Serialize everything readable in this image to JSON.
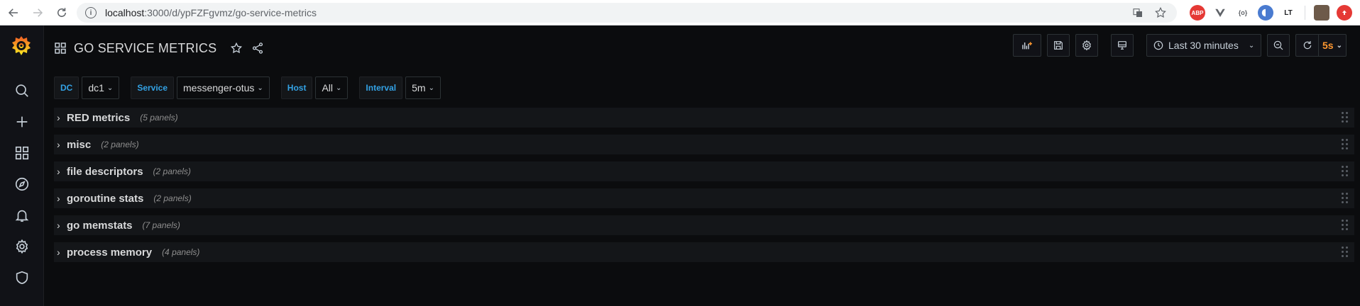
{
  "browser": {
    "url_host": "localhost",
    "url_path": ":3000/d/ypFZFgvmz/go-service-metrics",
    "extensions": [
      "ABP",
      "LT"
    ]
  },
  "dashboard": {
    "title": "GO SERVICE METRICS",
    "time_range": "Last 30 minutes",
    "refresh": "5s"
  },
  "variables": [
    {
      "label": "DC",
      "value": "dc1"
    },
    {
      "label": "Service",
      "value": "messenger-otus"
    },
    {
      "label": "Host",
      "value": "All"
    },
    {
      "label": "Interval",
      "value": "5m"
    }
  ],
  "rows": [
    {
      "title": "RED metrics",
      "count": "(5 panels)"
    },
    {
      "title": "misc",
      "count": "(2 panels)"
    },
    {
      "title": "file descriptors",
      "count": "(2 panels)"
    },
    {
      "title": "goroutine stats",
      "count": "(2 panels)"
    },
    {
      "title": "go memstats",
      "count": "(7 panels)"
    },
    {
      "title": "process memory",
      "count": "(4 panels)"
    }
  ],
  "colors": {
    "accent_orange": "#ff9830",
    "variable_label_blue": "#33a2e5",
    "background": "#0b0c0e",
    "row_bg": "#141619"
  },
  "icons": {
    "sidebar": [
      "grafana-logo",
      "search-icon",
      "plus-icon",
      "dashboards-icon",
      "explore-icon",
      "alert-bell-icon",
      "gear-icon",
      "shield-icon"
    ],
    "toolbar": [
      "add-panel-icon",
      "save-icon",
      "settings-icon",
      "tv-mode-icon",
      "clock-icon",
      "zoom-out-icon",
      "refresh-icon"
    ]
  }
}
